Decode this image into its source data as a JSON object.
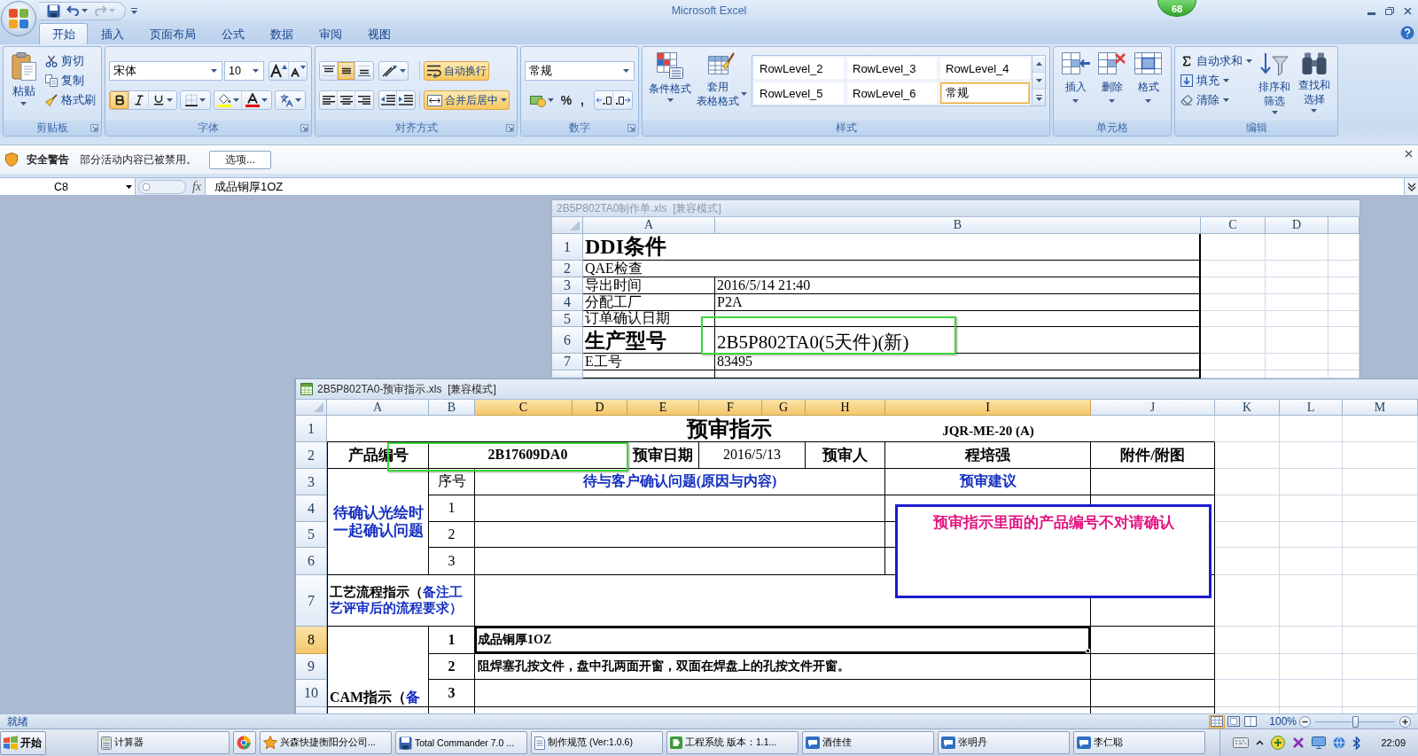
{
  "window": {
    "title": "Microsoft Excel",
    "badge": "68",
    "quick_access": [
      {
        "kind": "save",
        "disabled": false
      },
      {
        "kind": "undo",
        "disabled": false
      },
      {
        "kind": "redo",
        "disabled": true
      }
    ]
  },
  "ribbon_tabs": [
    {
      "label": "开始",
      "selected": true
    },
    {
      "label": "插入",
      "selected": false
    },
    {
      "label": "页面布局",
      "selected": false
    },
    {
      "label": "公式",
      "selected": false
    },
    {
      "label": "数据",
      "selected": false
    },
    {
      "label": "审阅",
      "selected": false
    },
    {
      "label": "视图",
      "selected": false
    }
  ],
  "ribbon": {
    "clipboard": {
      "label": "剪贴板",
      "paste": "粘贴",
      "tools": [
        {
          "kind": "cut",
          "label": "剪切"
        },
        {
          "kind": "copy",
          "label": "复制"
        },
        {
          "kind": "format_painter",
          "label": "格式刷"
        }
      ]
    },
    "font": {
      "label": "字体",
      "font_name": "宋体",
      "font_size": "10",
      "styles": [
        {
          "kind": "bold",
          "selected": true
        },
        {
          "kind": "italic",
          "selected": false
        },
        {
          "kind": "underline",
          "selected": false
        }
      ]
    },
    "alignment": {
      "label": "对齐方式",
      "vertical": [
        {
          "kind": "top",
          "selected": false
        },
        {
          "kind": "middle",
          "selected": true
        },
        {
          "kind": "bottom",
          "selected": false
        }
      ],
      "horizontal": [
        {
          "kind": "left",
          "selected": false
        },
        {
          "kind": "center",
          "selected": false
        },
        {
          "kind": "right",
          "selected": false
        }
      ],
      "wrap_text": {
        "label": "自动换行",
        "on": true
      },
      "merge_center": {
        "label": "合并后居中",
        "on": true
      }
    },
    "number": {
      "label": "数字",
      "format": "常规",
      "percent": "%",
      "comma": ","
    },
    "styles": {
      "label": "样式",
      "conditional_formatting": "条件格式",
      "format_as_table": [
        "套用",
        "表格格式"
      ],
      "gallery": [
        {
          "label": "RowLevel_2",
          "selected": false
        },
        {
          "label": "RowLevel_3",
          "selected": false
        },
        {
          "label": "RowLevel_4",
          "selected": false
        },
        {
          "label": "RowLevel_5",
          "selected": false
        },
        {
          "label": "RowLevel_6",
          "selected": false
        },
        {
          "label": "常规",
          "selected": true
        }
      ]
    },
    "cells": {
      "label": "单元格",
      "buttons": [
        {
          "kind": "insert",
          "label": "插入"
        },
        {
          "kind": "delete",
          "label": "删除"
        },
        {
          "kind": "format",
          "label": "格式"
        }
      ]
    },
    "editing": {
      "label": "编辑",
      "tools": [
        {
          "kind": "autosum",
          "label": "自动求和"
        },
        {
          "kind": "fill",
          "label": "填充"
        },
        {
          "kind": "clear",
          "label": "清除"
        }
      ],
      "sort_filter": [
        "排序和",
        "筛选"
      ],
      "find_select": [
        "查找和",
        "选择"
      ]
    }
  },
  "security_bar": {
    "title": "安全警告",
    "message": "部分活动内容已被禁用。",
    "button": "选项..."
  },
  "formula_bar": {
    "name_box": "C8",
    "function_button": "fx",
    "content": "成品铜厚1OZ"
  },
  "back_workbook": {
    "title": "2B5P802TA0制作单.xls  [兼容模式]",
    "columns": [
      "A",
      "B",
      "C",
      "D"
    ],
    "rows": [
      {
        "number": "1",
        "kind": "heading",
        "a": "DDI条件"
      },
      {
        "number": "2",
        "kind": "merged",
        "a": "QAE检查"
      },
      {
        "number": "3",
        "kind": "pair",
        "a": "导出时间",
        "b": "2016/5/14 21:40"
      },
      {
        "number": "4",
        "kind": "pair",
        "a": "分配工厂",
        "b": "P2A"
      },
      {
        "number": "5",
        "kind": "pair",
        "a": "订单确认日期"
      },
      {
        "number": "6",
        "kind": "large_pair",
        "a": "生产型号",
        "b": "2B5P802TA0(5天件)(新)"
      },
      {
        "number": "7",
        "kind": "pair",
        "a": "E工号",
        "b": "83495"
      }
    ]
  },
  "front_workbook": {
    "title": "2B5P802TA0-预审指示.xls  [兼容模式]",
    "columns": [
      {
        "label": "A",
        "selected": false
      },
      {
        "label": "B",
        "selected": false
      },
      {
        "label": "C",
        "selected": true
      },
      {
        "label": "D",
        "selected": true
      },
      {
        "label": "E",
        "selected": true
      },
      {
        "label": "F",
        "selected": true
      },
      {
        "label": "G",
        "selected": true
      },
      {
        "label": "H",
        "selected": true
      },
      {
        "label": "I",
        "selected": true
      },
      {
        "label": "J",
        "selected": false
      },
      {
        "label": "K",
        "selected": false
      },
      {
        "label": "L",
        "selected": false
      },
      {
        "label": "M",
        "selected": false
      }
    ],
    "rows": [
      {
        "label": "1",
        "selected": false
      },
      {
        "label": "2",
        "selected": false
      },
      {
        "label": "3",
        "selected": false
      },
      {
        "label": "4",
        "selected": false
      },
      {
        "label": "5",
        "selected": false
      },
      {
        "label": "6",
        "selected": false
      },
      {
        "label": "7",
        "selected": false
      },
      {
        "label": "8",
        "selected": true
      },
      {
        "label": "9",
        "selected": false
      },
      {
        "label": "10",
        "selected": false
      }
    ],
    "form": {
      "title": "预审指示",
      "doc_code": "JQR-ME-20 (A)",
      "header": {
        "product_label": "产品编号",
        "product_no": "2B17609DA0",
        "date_label": "预审日期",
        "date": "2016/5/13",
        "reviewer_label": "预审人",
        "reviewer": "程培强",
        "attachment_label": "附件/附图"
      },
      "confirm": {
        "label": [
          "待确认光绘时",
          "一起确认问题"
        ],
        "seq_header": "序号",
        "issue_header": "待与客户确认问题(原因与内容)",
        "advice_header": "预审建议",
        "items": [
          "1",
          "2",
          "3"
        ]
      },
      "process": {
        "label": "工艺流程指示（",
        "note": "备注工艺评审后的流程要求）"
      },
      "cam": {
        "label": "CAM指示（",
        "note": "备",
        "items": [
          {
            "seq": "1",
            "text": "成品铜厚1OZ",
            "selected": true
          },
          {
            "seq": "2",
            "text": "阻焊塞孔按文件，盘中孔两面开窗，双面在焊盘上的孔按文件开窗。",
            "selected": false
          },
          {
            "seq": "3",
            "selected": false
          }
        ]
      }
    },
    "note_box": "预审指示里面的产品编号不对请确认"
  },
  "status_bar": {
    "text": "就绪",
    "views": [
      {
        "kind": "normal",
        "selected": true
      },
      {
        "kind": "page_layout",
        "selected": false
      },
      {
        "kind": "page_break",
        "selected": false
      }
    ],
    "zoom": "100%",
    "zoom_slider": {
      "level": 0.5
    }
  },
  "taskbar": {
    "start": "开始",
    "items": [
      {
        "kind": "calculator",
        "label": "计算器"
      },
      {
        "kind": "browser"
      },
      {
        "kind": "star",
        "label": "兴森快捷衡阳分公司..."
      },
      {
        "kind": "disk",
        "label": "Total Commander 7.0 ..."
      },
      {
        "kind": "document",
        "label": "制作规范 (Ver:1.0.6)"
      },
      {
        "kind": "app",
        "label": "工程系统  版本：1.1..."
      },
      {
        "kind": "chat",
        "label": "酒佳佳"
      },
      {
        "kind": "chat",
        "label": "张明丹"
      },
      {
        "kind": "chat",
        "label": "李仁聪"
      }
    ],
    "clock": "22:09"
  }
}
